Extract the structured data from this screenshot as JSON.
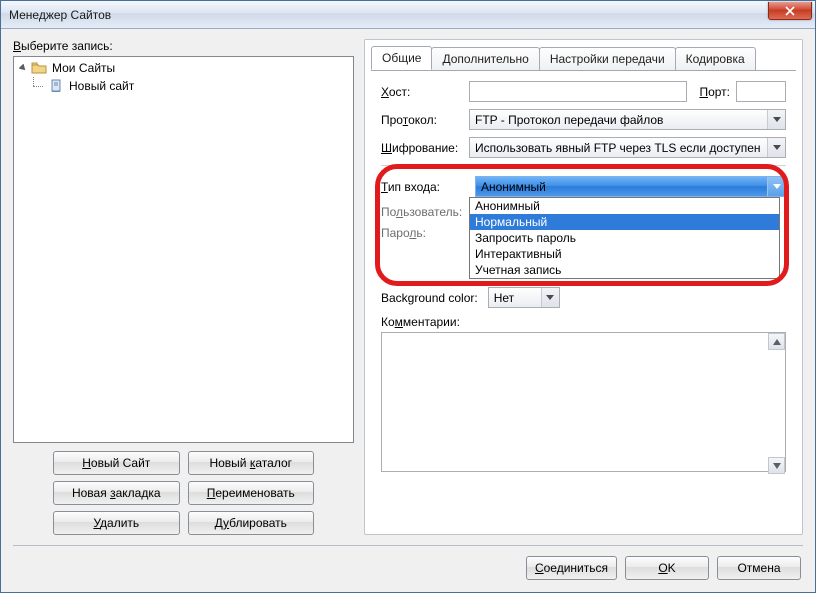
{
  "window": {
    "title": "Менеджер Сайтов"
  },
  "left": {
    "select_label": "Выберите запись:",
    "tree": {
      "root": "Мои Сайты",
      "child": "Новый сайт"
    },
    "buttons": {
      "new_site": "Новый Сайт",
      "new_folder": "Новый каталог",
      "new_bookmark": "Новая закладка",
      "rename": "Переименовать",
      "delete": "Удалить",
      "duplicate": "Дублировать"
    }
  },
  "tabs": {
    "general": "Общие",
    "advanced": "Дополнительно",
    "transfer": "Настройки передачи",
    "charset": "Кодировка"
  },
  "form": {
    "host_label": "Хост:",
    "host_value": "",
    "port_label": "Порт:",
    "port_value": "",
    "protocol_label": "Протокол:",
    "protocol_value": "FTP - Протокол передачи файлов",
    "encryption_label": "Шифрование:",
    "encryption_value": "Использовать явный FTP через TLS если доступен",
    "logon_label": "Тип входа:",
    "logon_selected": "Анонимный",
    "logon_options": [
      "Анонимный",
      "Нормальный",
      "Запросить пароль",
      "Интерактивный",
      "Учетная запись"
    ],
    "logon_highlight_index": 1,
    "user_label": "Пользователь:",
    "pass_label": "Пароль:",
    "bgcolor_label": "Background color:",
    "bgcolor_value": "Нет",
    "comments_label": "Комментарии:",
    "comments_value": ""
  },
  "footer": {
    "connect": "Соединиться",
    "ok": "OK",
    "cancel": "Отмена"
  }
}
